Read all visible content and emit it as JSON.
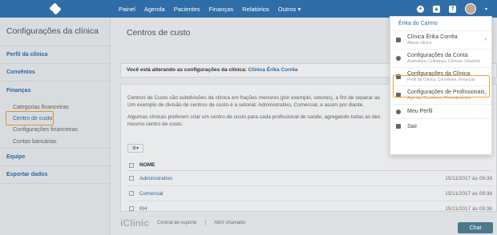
{
  "nav": [
    "Painel",
    "Agenda",
    "Pacientes",
    "Finanças",
    "Relatórios",
    "Outros"
  ],
  "sidebar": {
    "title": "Configurações da clínica",
    "sections": [
      "Perfil da clínica",
      "Convênios",
      "Finanças",
      "Equipe",
      "Exportar dados"
    ],
    "finance_items": [
      "Categorias financeiras",
      "Centro de custo",
      "Configurações financeiras",
      "Contas bancárias"
    ]
  },
  "main": {
    "title": "Centros de custo",
    "alert_prefix": "Você está alterando as configurações da clínica:",
    "alert_clinic": "Clínica Érika Corrêa",
    "desc1": "Centros de Custo são subdivisões da clínica em frações menores (por exemplo, setores), a fim de separar as",
    "desc2": "Um exemplo de divisão de centros de custo é a setorial: Administrativo, Comercial, e assim por diante.",
    "desc3": "Algumas clínicas preferem criar um centro de custo para cada profissional de saúde, agregando todas as des",
    "desc4": "mesmo centro de custo.",
    "col_name": "NOME",
    "rows": [
      {
        "name": "Administrativo",
        "date": "15/11/2017 às 09:38"
      },
      {
        "name": "Comercial",
        "date": "15/11/2017 às 09:38"
      },
      {
        "name": "RH",
        "date": "15/11/2017 às 09:38"
      }
    ]
  },
  "footer": {
    "brand": "iClinic",
    "support": "Central de suporte",
    "sep": "|",
    "ticket": "Abrir chamado"
  },
  "chat": "Chat",
  "dropdown": {
    "user": "Érika do Carmo",
    "items": [
      {
        "title": "Clínica Érika Corrêa",
        "sub": "Alterar clínica",
        "arrow": true
      },
      {
        "title": "Configurações da Conta",
        "sub": "Assinatura, Cobrança, Clínicas, Usuários",
        "arrow": false
      },
      {
        "title": "Configurações da Clínica",
        "sub": "Perfil da Clínica, Convênios, Finanças",
        "arrow": false
      },
      {
        "title": "Configurações de Profissionais",
        "sub": "Agenda, Convênios, Procedimentos",
        "arrow": true
      },
      {
        "title": "Meu Perfil",
        "sub": "",
        "arrow": false
      },
      {
        "title": "Sair",
        "sub": "",
        "arrow": false
      }
    ]
  }
}
